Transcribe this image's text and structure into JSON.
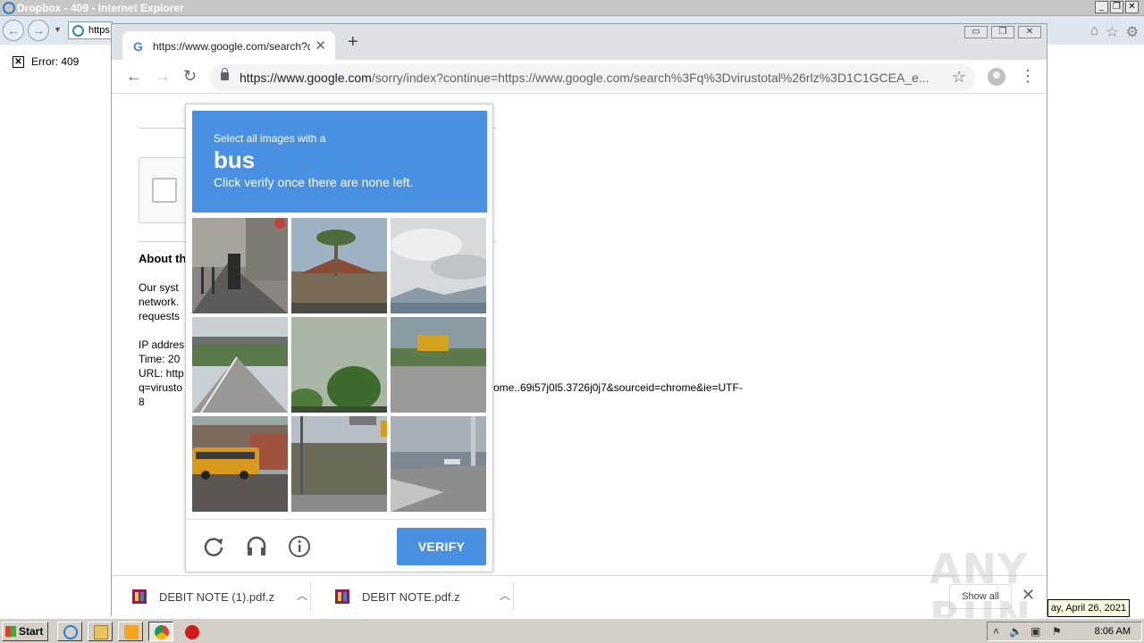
{
  "ie": {
    "title": "Dropbox - 409 - Internet Explorer",
    "address_partial": "https",
    "error_text": "Error: 409"
  },
  "chrome": {
    "tab_title": "https://www.google.com/search?q=",
    "url_host": "https://www.google.com",
    "url_rest": "/sorry/index?continue=https://www.google.com/search%3Fq%3Dvirustotal%26rlz%3D1C1GCEA_e..."
  },
  "sorry_page": {
    "about_heading": "About th",
    "para_lines": [
      "Our syst",
      "network.",
      "requests"
    ],
    "ip_line": "IP addres",
    "time_line": "Time: 20",
    "url_line": "URL: http",
    "q_line_start": "q=virusto",
    "q_line_end": "ome..69i57j0l5.3726j0j7&sourceid=chrome&ie=UTF-",
    "last_line": "8"
  },
  "captcha": {
    "instruction": "Select all images with a",
    "keyword": "bus",
    "sub_instruction": "Click verify once there are none left.",
    "verify_label": "VERIFY",
    "footer_icons": [
      "reload-icon",
      "audio-icon",
      "info-icon"
    ]
  },
  "downloads": {
    "items": [
      {
        "name": "DEBIT NOTE (1).pdf.z"
      },
      {
        "name": "DEBIT NOTE.pdf.z"
      }
    ],
    "show_all": "Show all"
  },
  "watermark": "ANY RUN",
  "date_tooltip": "ay, April 26, 2021",
  "taskbar": {
    "start_label": "Start",
    "clock": "8:06 AM"
  },
  "colors": {
    "captcha_blue": "#4a90e2",
    "chrome_tabstrip": "#dee1e6",
    "taskbar": "#d4d0c8"
  }
}
